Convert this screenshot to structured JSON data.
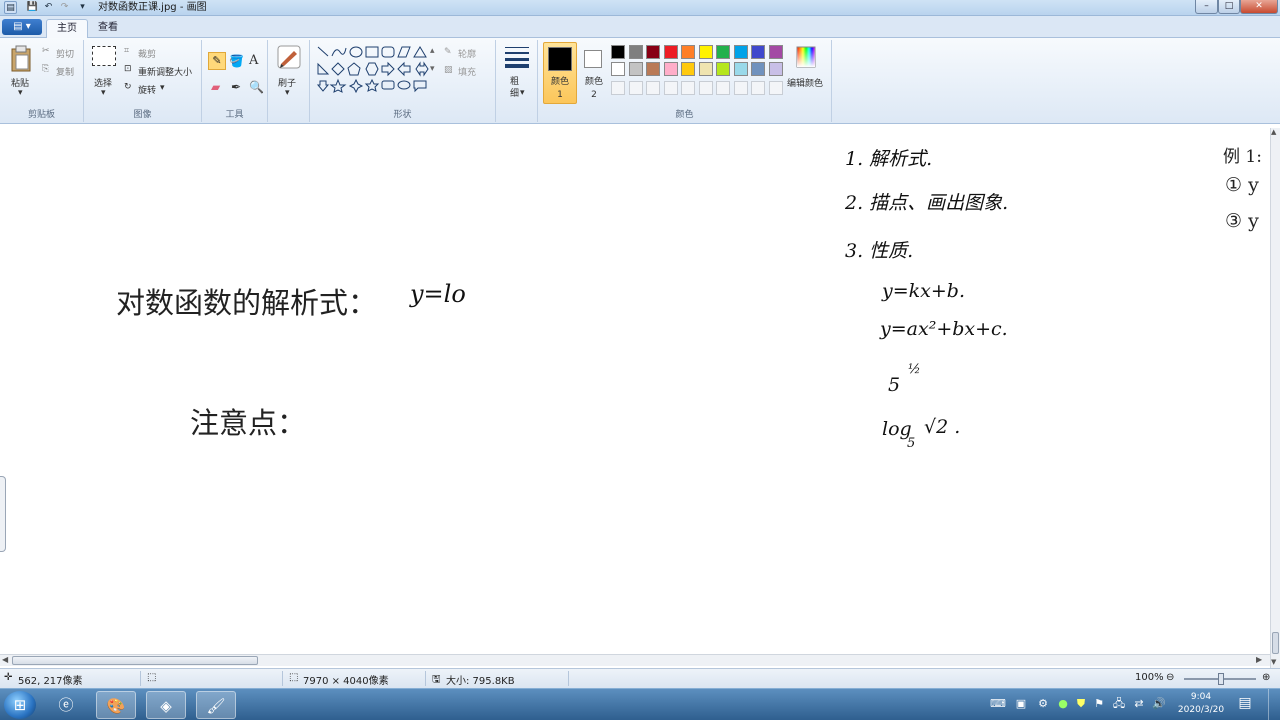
{
  "window": {
    "title": "对数函数正课.jpg - 画图",
    "quick_access": [
      "paint-icon",
      "save-icon",
      "undo-icon",
      "redo-icon",
      "dropdown-icon"
    ],
    "controls": [
      "–",
      "□",
      "✕"
    ]
  },
  "tabs": {
    "menu_button": "▤ ▾",
    "items": [
      "主页",
      "查看"
    ],
    "active": "主页"
  },
  "ribbon": {
    "clipboard": {
      "label": "剪贴板",
      "paste": "粘贴",
      "cut": "剪切",
      "copy": "复制"
    },
    "image": {
      "label": "图像",
      "select": "选择",
      "crop": "裁剪",
      "resize": "重新调整大小",
      "rotate": "旋转"
    },
    "tools": {
      "label": "工具"
    },
    "brushes": {
      "label": "刷子"
    },
    "shapes": {
      "label": "形状",
      "outline": "轮廓",
      "fill": "填充"
    },
    "size": {
      "label": "粗细"
    },
    "colors": {
      "label": "颜色",
      "color1": "颜色 1",
      "color2": "颜色 2",
      "edit": "编辑颜色",
      "color1_value": "#000000",
      "color2_value": "#ffffff",
      "palette_row1": [
        "#000000",
        "#7f7f7f",
        "#880015",
        "#ed1c24",
        "#ff7f27",
        "#fff200",
        "#22b14c",
        "#00a2e8",
        "#3f48cc",
        "#a349a4"
      ],
      "palette_row2": [
        "#ffffff",
        "#c3c3c3",
        "#b97a57",
        "#ffaec9",
        "#ffc90e",
        "#efe4b0",
        "#b5e61d",
        "#99d9ea",
        "#7092be",
        "#c8bfe7"
      ]
    }
  },
  "canvas": {
    "heading": "对数函数的解析式：",
    "heading_hand": "y=lo",
    "note": "注意点：",
    "outline": [
      "1. 解析式.",
      "2. 描点、画出图象.",
      "3. 性质."
    ],
    "formulas": [
      "y=kx+b.",
      "y=ax²+bx+c.",
      "5",
      "½",
      "log",
      "5",
      "√2 ."
    ],
    "example": {
      "title": "例 1:",
      "items": [
        "① y",
        "③ y"
      ]
    }
  },
  "status": {
    "cursor": "562, 217像素",
    "dimensions": "7970 × 4040像素",
    "size": "大小: 795.8KB",
    "zoom": "100%"
  },
  "taskbar": {
    "time": "9:04",
    "date": "2020/3/20",
    "apps": [
      "start-orb",
      "ie-icon",
      "paint-icon",
      "app-icon",
      "paint-active-icon"
    ]
  }
}
